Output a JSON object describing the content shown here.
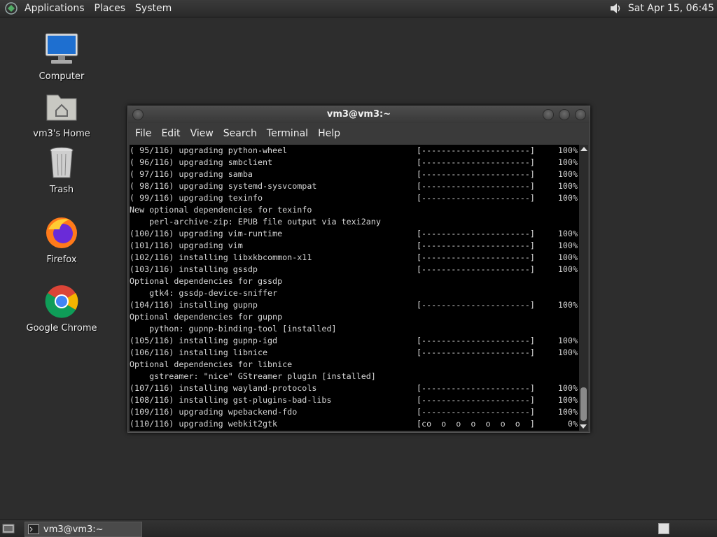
{
  "top_panel": {
    "menus": [
      "Applications",
      "Places",
      "System"
    ],
    "clock": "Sat Apr 15, 06:45",
    "icons": {
      "distro": "distro-logo-icon",
      "volume": "volume-icon"
    }
  },
  "desktop_icons": [
    {
      "label": "Computer",
      "icon": "computer-icon"
    },
    {
      "label": "vm3's Home",
      "icon": "home-folder-icon"
    },
    {
      "label": "Trash",
      "icon": "trash-icon"
    },
    {
      "label": "Firefox",
      "icon": "firefox-icon"
    },
    {
      "label": "Google Chrome",
      "icon": "chrome-icon"
    }
  ],
  "terminal": {
    "title": "vm3@vm3:~",
    "menu": [
      "File",
      "Edit",
      "View",
      "Search",
      "Terminal",
      "Help"
    ],
    "lines": [
      {
        "text": "( 95/116) upgrading python-wheel",
        "bar": "[----------------------]",
        "pct": "100%"
      },
      {
        "text": "( 96/116) upgrading smbclient",
        "bar": "[----------------------]",
        "pct": "100%"
      },
      {
        "text": "( 97/116) upgrading samba",
        "bar": "[----------------------]",
        "pct": "100%"
      },
      {
        "text": "( 98/116) upgrading systemd-sysvcompat",
        "bar": "[----------------------]",
        "pct": "100%"
      },
      {
        "text": "( 99/116) upgrading texinfo",
        "bar": "[----------------------]",
        "pct": "100%"
      },
      {
        "text": "New optional dependencies for texinfo",
        "bar": "",
        "pct": ""
      },
      {
        "text": "    perl-archive-zip: EPUB file output via texi2any",
        "bar": "",
        "pct": ""
      },
      {
        "text": "(100/116) upgrading vim-runtime",
        "bar": "[----------------------]",
        "pct": "100%"
      },
      {
        "text": "(101/116) upgrading vim",
        "bar": "[----------------------]",
        "pct": "100%"
      },
      {
        "text": "(102/116) installing libxkbcommon-x11",
        "bar": "[----------------------]",
        "pct": "100%"
      },
      {
        "text": "(103/116) installing gssdp",
        "bar": "[----------------------]",
        "pct": "100%"
      },
      {
        "text": "Optional dependencies for gssdp",
        "bar": "",
        "pct": ""
      },
      {
        "text": "    gtk4: gssdp-device-sniffer",
        "bar": "",
        "pct": ""
      },
      {
        "text": "(104/116) installing gupnp",
        "bar": "[----------------------]",
        "pct": "100%"
      },
      {
        "text": "Optional dependencies for gupnp",
        "bar": "",
        "pct": ""
      },
      {
        "text": "    python: gupnp-binding-tool [installed]",
        "bar": "",
        "pct": ""
      },
      {
        "text": "(105/116) installing gupnp-igd",
        "bar": "[----------------------]",
        "pct": "100%"
      },
      {
        "text": "(106/116) installing libnice",
        "bar": "[----------------------]",
        "pct": "100%"
      },
      {
        "text": "Optional dependencies for libnice",
        "bar": "",
        "pct": ""
      },
      {
        "text": "    gstreamer: \"nice\" GStreamer plugin [installed]",
        "bar": "",
        "pct": ""
      },
      {
        "text": "(107/116) installing wayland-protocols",
        "bar": "[----------------------]",
        "pct": "100%"
      },
      {
        "text": "(108/116) installing gst-plugins-bad-libs",
        "bar": "[----------------------]",
        "pct": "100%"
      },
      {
        "text": "(109/116) upgrading wpebackend-fdo",
        "bar": "[----------------------]",
        "pct": "100%"
      },
      {
        "text": "(110/116) upgrading webkit2gtk",
        "bar": "[co  o  o  o  o  o  o  ]",
        "pct": "0%"
      }
    ]
  },
  "taskbar": {
    "task_label": "vm3@vm3:~"
  }
}
